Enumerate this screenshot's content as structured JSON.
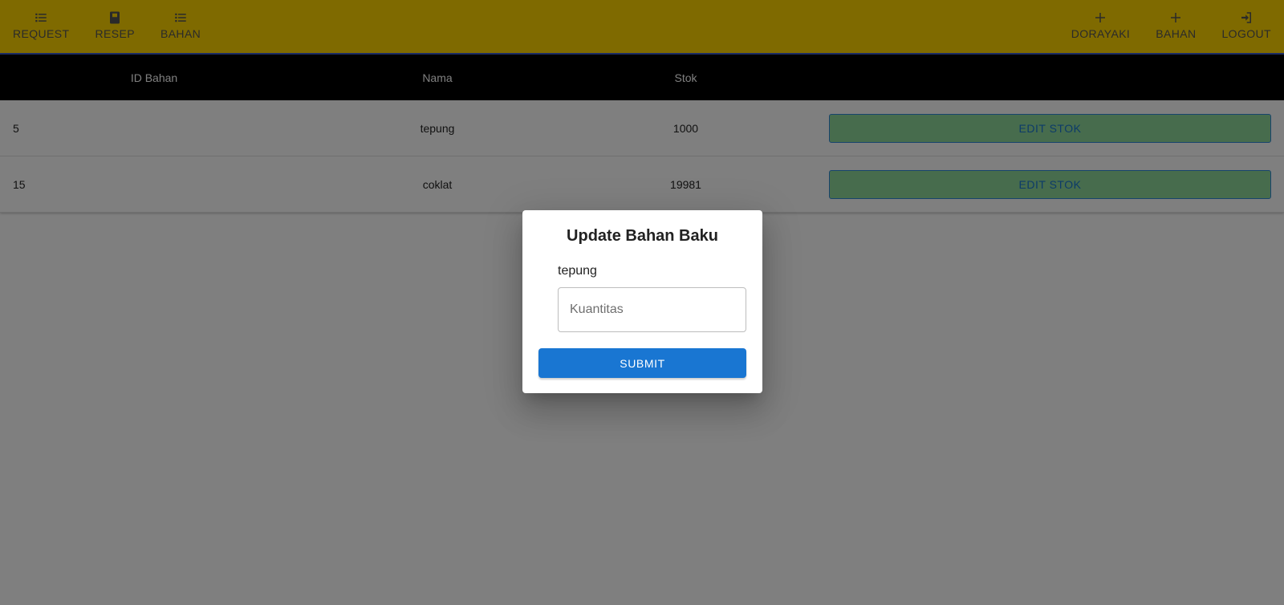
{
  "nav": {
    "left_items": [
      {
        "label": "REQUEST",
        "icon": "list-icon"
      },
      {
        "label": "RESEP",
        "icon": "book-icon"
      },
      {
        "label": "BAHAN",
        "icon": "list-icon"
      }
    ],
    "right_items": [
      {
        "label": "DORAYAKI",
        "icon": "plus-icon"
      },
      {
        "label": "BAHAN",
        "icon": "plus-icon"
      },
      {
        "label": "LOGOUT",
        "icon": "logout-icon"
      }
    ]
  },
  "table": {
    "headers": {
      "id": "ID Bahan",
      "nama": "Nama",
      "stok": "Stok"
    },
    "rows": [
      {
        "id": "5",
        "nama": "tepung",
        "stok": "1000",
        "action": "EDIT STOK"
      },
      {
        "id": "15",
        "nama": "coklat",
        "stok": "19981",
        "action": "EDIT STOK"
      }
    ]
  },
  "modal": {
    "title": "Update Bahan Baku",
    "item_name": "tepung",
    "quantity_placeholder": "Kuantitas",
    "quantity_value": "",
    "submit_label": "SUBMIT"
  },
  "colors": {
    "navbar": "#ffd400",
    "table_header": "#000000",
    "edit_button_bg": "#8fd99a",
    "edit_button_text": "#1976d2",
    "submit_button": "#1976d2"
  }
}
